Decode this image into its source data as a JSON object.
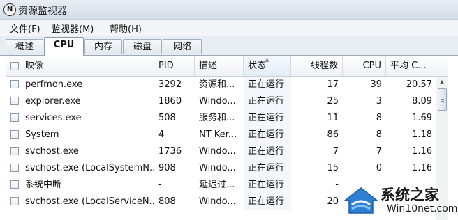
{
  "window": {
    "title": "资源监视器",
    "icon_glyph": "N"
  },
  "menu": {
    "items": [
      "文件(F)",
      "监视器(M)",
      "帮助(H)"
    ]
  },
  "tabs": {
    "items": [
      "概述",
      "CPU",
      "内存",
      "磁盘",
      "网络"
    ],
    "active": "CPU"
  },
  "table": {
    "columns": [
      "映像",
      "PID",
      "描述",
      "状态",
      "线程数",
      "CPU",
      "平均 C..."
    ],
    "sorted_column": "状态",
    "rows": [
      [
        "perfmon.exe",
        "3292",
        "资源和...",
        "正在运行",
        "17",
        "39",
        "20.57"
      ],
      [
        "explorer.exe",
        "1860",
        "Windo...",
        "正在运行",
        "25",
        "3",
        "8.09"
      ],
      [
        "services.exe",
        "508",
        "服务和...",
        "正在运行",
        "11",
        "8",
        "1.69"
      ],
      [
        "System",
        "4",
        "NT Ker...",
        "正在运行",
        "86",
        "8",
        "1.18"
      ],
      [
        "svchost.exe",
        "1736",
        "Windo...",
        "正在运行",
        "7",
        "7",
        "1.16"
      ],
      [
        "svchost.exe (LocalSystemN...",
        "908",
        "Windo...",
        "正在运行",
        "15",
        "0",
        "1.16"
      ],
      [
        "系统中断",
        "-",
        "延迟过...",
        "正在运行",
        "-",
        "",
        ""
      ],
      [
        "svchost.exe (LocalServiceN...",
        "808",
        "Windo...",
        "正在运行",
        "20",
        "",
        ""
      ]
    ]
  },
  "watermark": {
    "title": "系统之家",
    "subtitle": "Win10net.com"
  }
}
